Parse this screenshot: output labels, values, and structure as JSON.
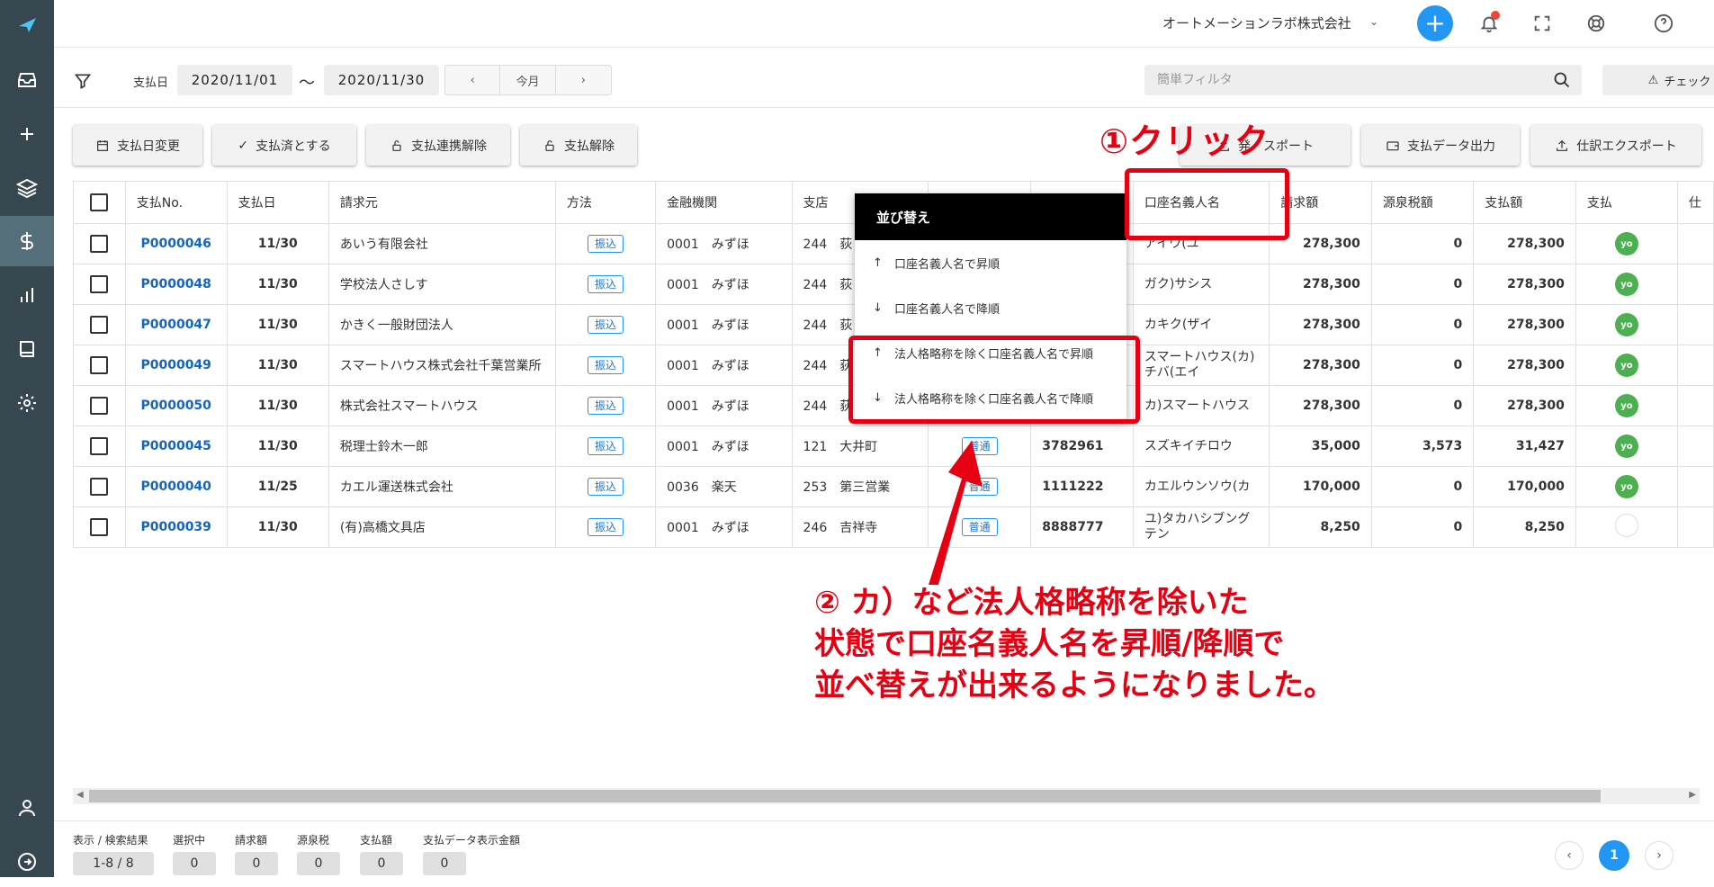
{
  "header": {
    "company": "オートメーションラボ株式会社",
    "company_chevron": "⌄",
    "add": "+"
  },
  "filter": {
    "label": "支払日",
    "date_from": "2020/11/01",
    "tilde": "〜",
    "date_to": "2020/11/30",
    "prev": "‹",
    "this_month": "今月",
    "next": "›",
    "search_placeholder": "簡単フィルタ",
    "check_label": "チェック"
  },
  "actions": {
    "change_date": "支払日変更",
    "mark_paid": "支払済とする",
    "unlink": "支払連携解除",
    "cancel_payment": "支払解除",
    "export": "発　スポート",
    "payment_data": "支払データ出力",
    "journal_export": "仕訳エクスポート"
  },
  "table": {
    "headers": [
      "支払No.",
      "支払日",
      "請求元",
      "方法",
      "金融機関",
      "支店",
      "",
      "",
      "口座名義人名",
      "請求額",
      "源泉税額",
      "支払額",
      "支払",
      "仕"
    ],
    "rows": [
      {
        "no": "P0000046",
        "date": "11/30",
        "vendor": "あいう有限会社",
        "method": "振込",
        "bank": "0001　みずほ",
        "branch": "244　荻",
        "type": "",
        "account": "",
        "holder": "アイウ(ユ",
        "billed": "278,300",
        "withholding": "0",
        "paid": "278,300",
        "status": "yo"
      },
      {
        "no": "P0000048",
        "date": "11/30",
        "vendor": "学校法人さしす",
        "method": "振込",
        "bank": "0001　みずほ",
        "branch": "244　荻",
        "type": "",
        "account": "",
        "holder": "ガク)サシス",
        "billed": "278,300",
        "withholding": "0",
        "paid": "278,300",
        "status": "yo"
      },
      {
        "no": "P0000047",
        "date": "11/30",
        "vendor": "かきく一般財団法人",
        "method": "振込",
        "bank": "0001　みずほ",
        "branch": "244　荻",
        "type": "",
        "account": "",
        "holder": "カキク(ザイ",
        "billed": "278,300",
        "withholding": "0",
        "paid": "278,300",
        "status": "yo"
      },
      {
        "no": "P0000049",
        "date": "11/30",
        "vendor": "スマートハウス株式会社千葉営業所",
        "method": "振込",
        "bank": "0001　みずほ",
        "branch": "244　荻",
        "type": "",
        "account": "",
        "holder": "スマートハウス(カ)チバ(エイ",
        "billed": "278,300",
        "withholding": "0",
        "paid": "278,300",
        "status": "yo"
      },
      {
        "no": "P0000050",
        "date": "11/30",
        "vendor": "株式会社スマートハウス",
        "method": "振込",
        "bank": "0001　みずほ",
        "branch": "244　荻",
        "type": "",
        "account": "",
        "holder": "カ)スマートハウス",
        "billed": "278,300",
        "withholding": "0",
        "paid": "278,300",
        "status": "yo"
      },
      {
        "no": "P0000045",
        "date": "11/30",
        "vendor": "税理士鈴木一郎",
        "method": "振込",
        "bank": "0001　みずほ",
        "branch": "121　大井町",
        "type": "普通",
        "account": "3782961",
        "holder": "スズキイチロウ",
        "billed": "35,000",
        "withholding": "3,573",
        "paid": "31,427",
        "status": "yo"
      },
      {
        "no": "P0000040",
        "date": "11/25",
        "vendor": "カエル運送株式会社",
        "method": "振込",
        "bank": "0036　楽天",
        "branch": "253　第三営業",
        "type": "普通",
        "account": "1111222",
        "holder": "カエルウンソウ(カ",
        "billed": "170,000",
        "withholding": "0",
        "paid": "170,000",
        "status": "yo"
      },
      {
        "no": "P0000039",
        "date": "11/30",
        "vendor": "(有)高橋文具店",
        "method": "振込",
        "bank": "0001　みずほ",
        "branch": "246　吉祥寺",
        "type": "普通",
        "account": "8888777",
        "holder": "ユ)タカハシブングテン",
        "billed": "8,250",
        "withholding": "0",
        "paid": "8,250",
        "status": ""
      }
    ]
  },
  "sort_menu": {
    "title": "並び替え",
    "items": [
      {
        "arrow": "↑",
        "label": "口座名義人名で昇順"
      },
      {
        "arrow": "↓",
        "label": "口座名義人名で降順"
      },
      {
        "arrow": "↑",
        "label": "法人格略称を除く口座名義人名で昇順"
      },
      {
        "arrow": "↓",
        "label": "法人格略称を除く口座名義人名で降順"
      }
    ]
  },
  "annotations": {
    "step1": "①クリック",
    "step2_line1": "② カ）など法人格略称を除いた",
    "step2_line2": "状態で口座名義人名を昇順/降順で",
    "step2_line3": "並べ替えが出来るようになりました。",
    "color": "#e60012"
  },
  "footer": {
    "labels": [
      "表示 / 検索結果",
      "選択中",
      "請求額",
      "源泉税",
      "支払額",
      "支払データ表示金額"
    ],
    "values": [
      "1-8 / 8",
      "0",
      "0",
      "0",
      "0",
      "0"
    ],
    "page": "1",
    "prev": "‹",
    "next": "›"
  },
  "colors": {
    "sidebar": "#37474f",
    "primary": "#2196f3",
    "link": "#1565c0",
    "status_green": "#4caf50",
    "annotation_red": "#e60012"
  }
}
